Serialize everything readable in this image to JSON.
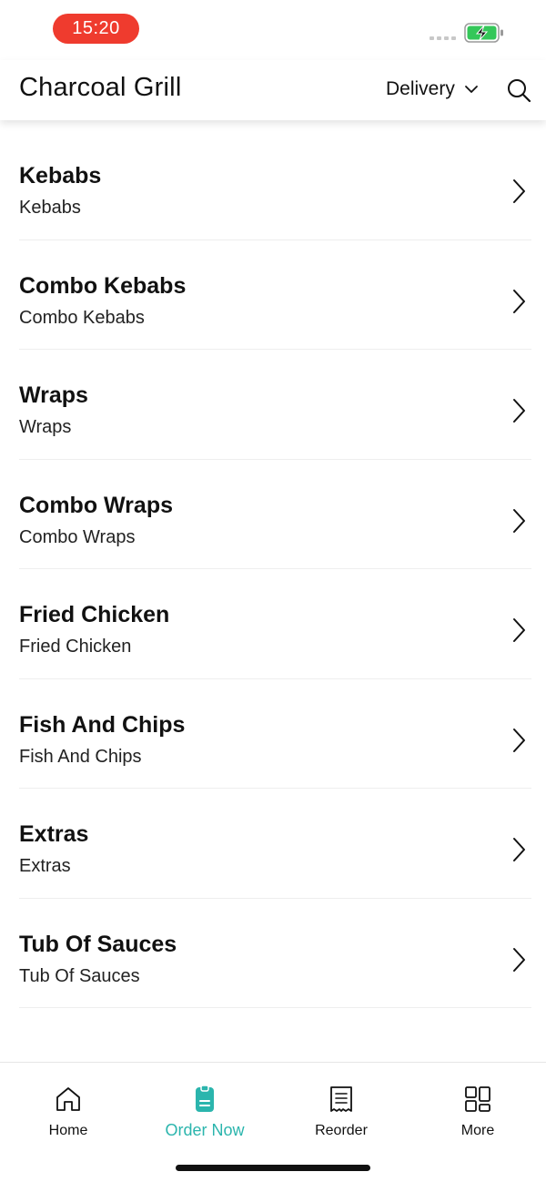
{
  "status_bar": {
    "time": "15:20",
    "icons": [
      "signal-icon",
      "battery-charging-icon"
    ]
  },
  "header": {
    "title": "Charcoal Grill",
    "mode_label": "Delivery",
    "icons": [
      "chevron-down-icon",
      "search-icon"
    ]
  },
  "menu": {
    "items": [
      {
        "title": "Kebabs",
        "subtitle": "Kebabs"
      },
      {
        "title": "Combo Kebabs",
        "subtitle": "Combo Kebabs"
      },
      {
        "title": "Wraps",
        "subtitle": "Wraps"
      },
      {
        "title": "Combo Wraps",
        "subtitle": "Combo Wraps"
      },
      {
        "title": "Fried Chicken",
        "subtitle": "Fried Chicken"
      },
      {
        "title": "Fish And Chips",
        "subtitle": "Fish And Chips"
      },
      {
        "title": "Extras",
        "subtitle": "Extras"
      },
      {
        "title": "Tub Of Sauces",
        "subtitle": "Tub Of Sauces"
      }
    ]
  },
  "tabbar": {
    "tabs": [
      {
        "label": "Home",
        "icon": "home-icon",
        "active": false
      },
      {
        "label": "Order Now",
        "icon": "order-icon",
        "active": true
      },
      {
        "label": "Reorder",
        "icon": "receipt-icon",
        "active": false
      },
      {
        "label": "More",
        "icon": "grid-icon",
        "active": false
      }
    ]
  },
  "colors": {
    "accent": "#2bb5ad",
    "time_pill": "#ef3b2e",
    "battery_fill": "#34c759"
  }
}
